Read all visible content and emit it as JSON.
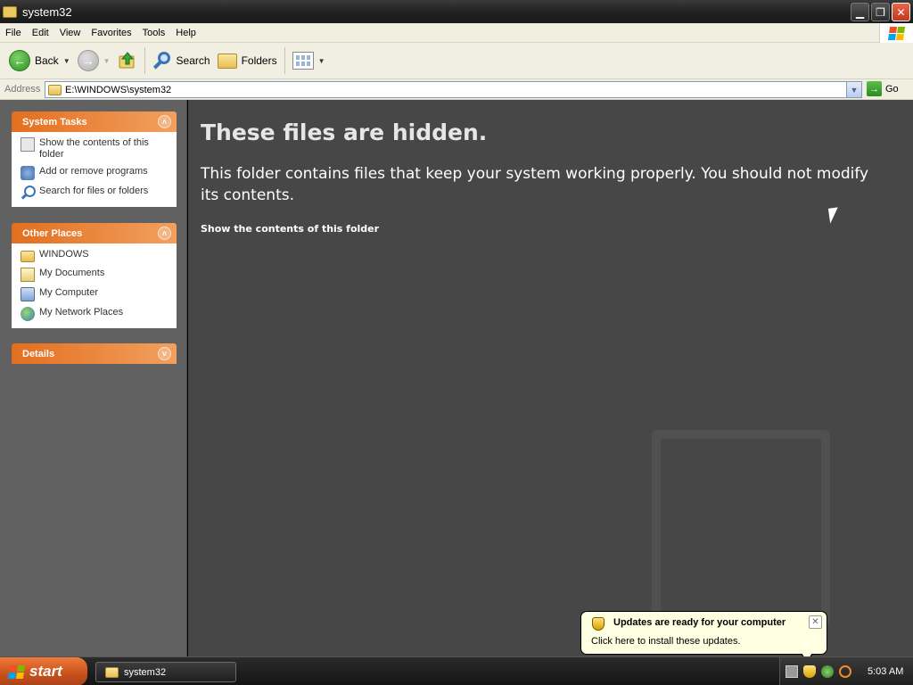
{
  "window": {
    "title": "system32",
    "min_glyph": "▁",
    "restore_glyph": "❐",
    "close_glyph": "✕"
  },
  "menu": [
    "File",
    "Edit",
    "View",
    "Favorites",
    "Tools",
    "Help"
  ],
  "toolbar": {
    "back_label": "Back",
    "search_label": "Search",
    "folders_label": "Folders"
  },
  "address": {
    "label": "Address",
    "value": "E:\\WINDOWS\\system32",
    "go_label": "Go"
  },
  "system_tasks": {
    "title": "System Tasks",
    "items": [
      {
        "label": "Show the contents of this folder",
        "icon": "show-contents-icon"
      },
      {
        "label": "Add or remove programs",
        "icon": "add-remove-programs-icon"
      },
      {
        "label": "Search for files or folders",
        "icon": "search-icon"
      }
    ]
  },
  "other_places": {
    "title": "Other Places",
    "items": [
      {
        "label": "WINDOWS",
        "icon": "folder-icon"
      },
      {
        "label": "My Documents",
        "icon": "my-documents-icon"
      },
      {
        "label": "My Computer",
        "icon": "my-computer-icon"
      },
      {
        "label": "My Network Places",
        "icon": "network-places-icon"
      }
    ]
  },
  "details": {
    "title": "Details"
  },
  "main": {
    "heading": "These files are hidden.",
    "description": "This folder contains files that keep your system working properly. You should not modify its contents.",
    "link": "Show the contents of this folder"
  },
  "taskbar": {
    "start_label": "start",
    "task_label": "system32",
    "clock": "5:03 AM"
  },
  "balloon": {
    "title": "Updates are ready for your computer",
    "text": "Click here to install these updates."
  },
  "colors": {
    "xp_red": "#f25022",
    "xp_green": "#7fba00",
    "xp_blue": "#00a4ef",
    "xp_yellow": "#ffb900",
    "panel_header": "#e36f1e",
    "main_bg": "#474747"
  }
}
